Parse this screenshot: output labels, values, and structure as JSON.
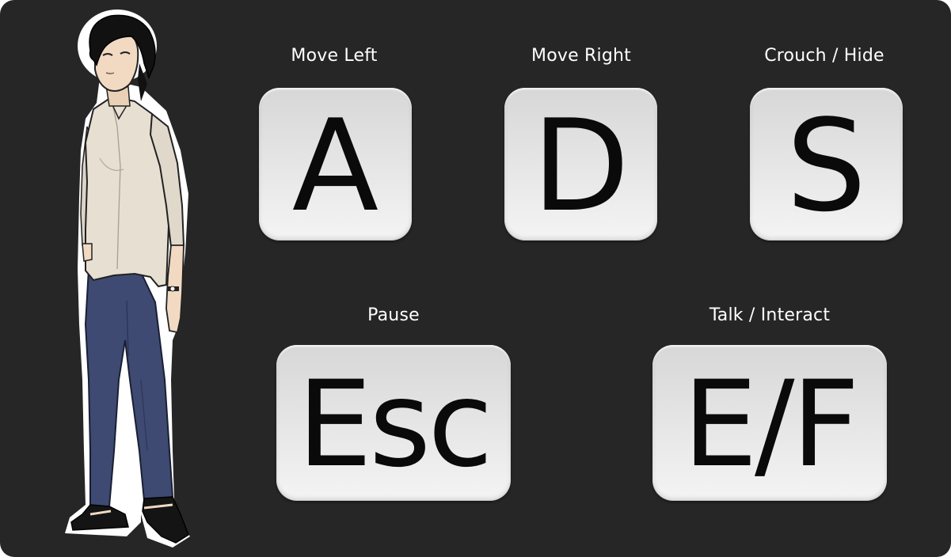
{
  "controls": {
    "move_left": {
      "label": "Move Left",
      "key": "A"
    },
    "move_right": {
      "label": "Move Right",
      "key": "D"
    },
    "crouch": {
      "label": "Crouch / Hide",
      "key": "S"
    },
    "pause": {
      "label": "Pause",
      "key": "Esc"
    },
    "interact": {
      "label": "Talk / Interact",
      "key": "E/F"
    }
  },
  "colors": {
    "background": "#262626",
    "label_text": "#ffffff",
    "key_face": "#e4e4e4",
    "key_glyph": "#0a0a0a",
    "shirt": "#e7dfd2",
    "pants": "#3e4a72",
    "hair": "#111111",
    "skin": "#f1d9c2"
  },
  "icons": {
    "character": "standing-woman-character"
  }
}
